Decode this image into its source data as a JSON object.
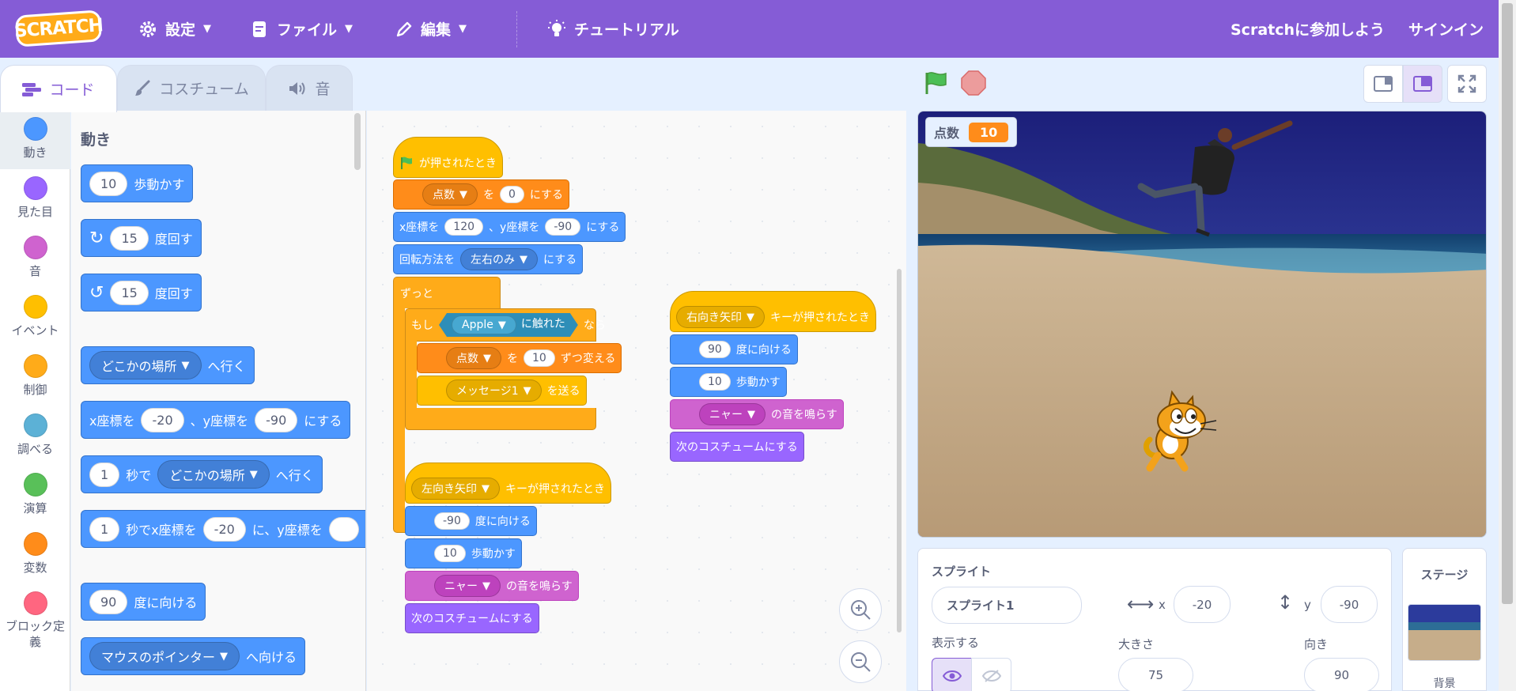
{
  "menu": {
    "logo": "SCRATCH",
    "settings": "設定",
    "file": "ファイル",
    "edit": "編集",
    "tutorials": "チュートリアル",
    "join": "Scratchに参加しよう",
    "signin": "サインイン"
  },
  "tabs": {
    "code": "コード",
    "costumes": "コスチューム",
    "sounds": "音"
  },
  "categories": [
    {
      "label": "動き",
      "color": "#4c97ff"
    },
    {
      "label": "見た目",
      "color": "#9966ff"
    },
    {
      "label": "音",
      "color": "#cf63cf"
    },
    {
      "label": "イベント",
      "color": "#ffbf00"
    },
    {
      "label": "制御",
      "color": "#ffab19"
    },
    {
      "label": "調べる",
      "color": "#5cb1d6"
    },
    {
      "label": "演算",
      "color": "#59c059"
    },
    {
      "label": "変数",
      "color": "#ff8c1a"
    },
    {
      "label": "ブロック定義",
      "color": "#ff6680"
    }
  ],
  "flyout": {
    "heading": "動き",
    "move_steps": "10",
    "move_label": "歩動かす",
    "turn_right_deg": "15",
    "turn_right_label": "度回す",
    "turn_left_deg": "15",
    "turn_left_label": "度回す",
    "goto_target": "どこかの場所",
    "goto_label": "へ行く",
    "setxy_a": "x座標を",
    "setxy_x": "-20",
    "setxy_b": "、y座標を",
    "setxy_y": "-90",
    "setxy_c": "にする",
    "glide1_secs": "1",
    "glide1_a": "秒で",
    "glide1_target": "どこかの場所",
    "glide1_b": "へ行く",
    "glide2_secs": "1",
    "glide2_a": "秒でx座標を",
    "glide2_x": "-20",
    "glide2_b": "に、y座標を",
    "point_deg": "90",
    "point_label": "度に向ける",
    "pointto_target": "マウスのポインター",
    "pointto_label": "へ向ける"
  },
  "script1": {
    "hat": "が押されたとき",
    "setvar_var": "点数",
    "setvar_a": "を",
    "setvar_val": "0",
    "setvar_b": "にする",
    "gotoxy_a": "x座標を",
    "gotoxy_x": "120",
    "gotoxy_b": "、y座標を",
    "gotoxy_y": "-90",
    "gotoxy_c": "にする",
    "rot_a": "回転方法を",
    "rot_val": "左右のみ",
    "rot_b": "にする",
    "forever": "ずっと",
    "if_a": "もし",
    "touch_target": "Apple",
    "touch_label": "に触れた",
    "if_b": "なら",
    "change_var": "点数",
    "change_a": "を",
    "change_val": "10",
    "change_b": "ずつ変える",
    "broadcast_msg": "メッセージ1",
    "broadcast_label": "を送る"
  },
  "script2": {
    "key": "右向き矢印",
    "hat": "キーが押されたとき",
    "dir": "90",
    "dir_label": "度に向ける",
    "steps": "10",
    "steps_label": "歩動かす",
    "sound": "ニャー",
    "sound_label": "の音を鳴らす",
    "next": "次のコスチュームにする"
  },
  "script3": {
    "key": "左向き矢印",
    "hat": "キーが押されたとき",
    "dir": "-90",
    "dir_label": "度に向ける",
    "steps": "10",
    "steps_label": "歩動かす",
    "sound": "ニャー",
    "sound_label": "の音を鳴らす",
    "next": "次のコスチュームにする"
  },
  "stage": {
    "monitor_label": "点数",
    "monitor_value": "10"
  },
  "sprite_info": {
    "heading": "スプライト",
    "name": "スプライト1",
    "x_label": "x",
    "x": "-20",
    "y_label": "y",
    "y": "-90",
    "show_label": "表示する",
    "size_label": "大きさ",
    "size": "75",
    "direction_label": "向き",
    "direction": "90"
  },
  "stage_pane": {
    "heading": "ステージ",
    "backdrop_label": "背景"
  },
  "colors": {
    "menu": "#855cd6",
    "motion": "#4c97ff",
    "events": "#ffbf00",
    "control": "#ffab19",
    "variables": "#ff8c1a",
    "sound": "#cf63cf",
    "looks": "#9966ff",
    "sensing": "#5cb1d6"
  }
}
